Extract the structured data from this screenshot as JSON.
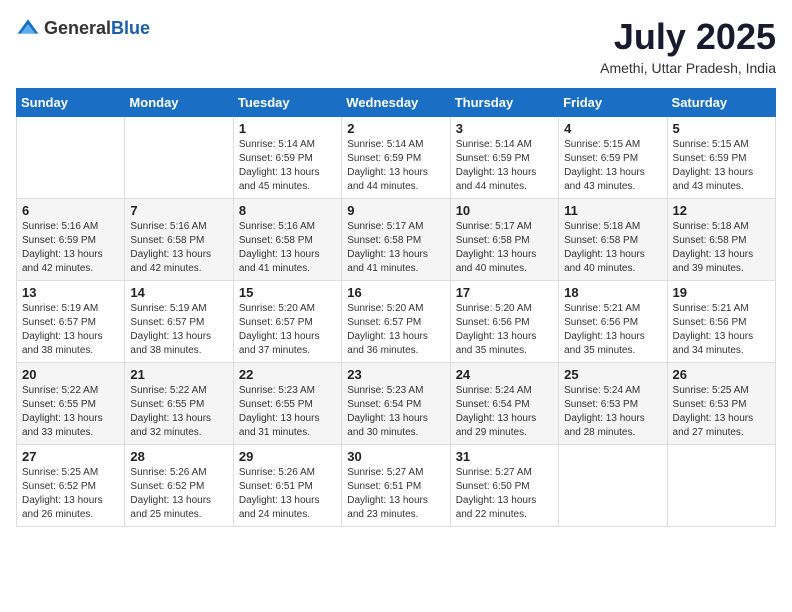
{
  "logo": {
    "general": "General",
    "blue": "Blue"
  },
  "title": "July 2025",
  "location": "Amethi, Uttar Pradesh, India",
  "days_of_week": [
    "Sunday",
    "Monday",
    "Tuesday",
    "Wednesday",
    "Thursday",
    "Friday",
    "Saturday"
  ],
  "weeks": [
    [
      {
        "day": "",
        "info": ""
      },
      {
        "day": "",
        "info": ""
      },
      {
        "day": "1",
        "info": "Sunrise: 5:14 AM\nSunset: 6:59 PM\nDaylight: 13 hours\nand 45 minutes."
      },
      {
        "day": "2",
        "info": "Sunrise: 5:14 AM\nSunset: 6:59 PM\nDaylight: 13 hours\nand 44 minutes."
      },
      {
        "day": "3",
        "info": "Sunrise: 5:14 AM\nSunset: 6:59 PM\nDaylight: 13 hours\nand 44 minutes."
      },
      {
        "day": "4",
        "info": "Sunrise: 5:15 AM\nSunset: 6:59 PM\nDaylight: 13 hours\nand 43 minutes."
      },
      {
        "day": "5",
        "info": "Sunrise: 5:15 AM\nSunset: 6:59 PM\nDaylight: 13 hours\nand 43 minutes."
      }
    ],
    [
      {
        "day": "6",
        "info": "Sunrise: 5:16 AM\nSunset: 6:59 PM\nDaylight: 13 hours\nand 42 minutes."
      },
      {
        "day": "7",
        "info": "Sunrise: 5:16 AM\nSunset: 6:58 PM\nDaylight: 13 hours\nand 42 minutes."
      },
      {
        "day": "8",
        "info": "Sunrise: 5:16 AM\nSunset: 6:58 PM\nDaylight: 13 hours\nand 41 minutes."
      },
      {
        "day": "9",
        "info": "Sunrise: 5:17 AM\nSunset: 6:58 PM\nDaylight: 13 hours\nand 41 minutes."
      },
      {
        "day": "10",
        "info": "Sunrise: 5:17 AM\nSunset: 6:58 PM\nDaylight: 13 hours\nand 40 minutes."
      },
      {
        "day": "11",
        "info": "Sunrise: 5:18 AM\nSunset: 6:58 PM\nDaylight: 13 hours\nand 40 minutes."
      },
      {
        "day": "12",
        "info": "Sunrise: 5:18 AM\nSunset: 6:58 PM\nDaylight: 13 hours\nand 39 minutes."
      }
    ],
    [
      {
        "day": "13",
        "info": "Sunrise: 5:19 AM\nSunset: 6:57 PM\nDaylight: 13 hours\nand 38 minutes."
      },
      {
        "day": "14",
        "info": "Sunrise: 5:19 AM\nSunset: 6:57 PM\nDaylight: 13 hours\nand 38 minutes."
      },
      {
        "day": "15",
        "info": "Sunrise: 5:20 AM\nSunset: 6:57 PM\nDaylight: 13 hours\nand 37 minutes."
      },
      {
        "day": "16",
        "info": "Sunrise: 5:20 AM\nSunset: 6:57 PM\nDaylight: 13 hours\nand 36 minutes."
      },
      {
        "day": "17",
        "info": "Sunrise: 5:20 AM\nSunset: 6:56 PM\nDaylight: 13 hours\nand 35 minutes."
      },
      {
        "day": "18",
        "info": "Sunrise: 5:21 AM\nSunset: 6:56 PM\nDaylight: 13 hours\nand 35 minutes."
      },
      {
        "day": "19",
        "info": "Sunrise: 5:21 AM\nSunset: 6:56 PM\nDaylight: 13 hours\nand 34 minutes."
      }
    ],
    [
      {
        "day": "20",
        "info": "Sunrise: 5:22 AM\nSunset: 6:55 PM\nDaylight: 13 hours\nand 33 minutes."
      },
      {
        "day": "21",
        "info": "Sunrise: 5:22 AM\nSunset: 6:55 PM\nDaylight: 13 hours\nand 32 minutes."
      },
      {
        "day": "22",
        "info": "Sunrise: 5:23 AM\nSunset: 6:55 PM\nDaylight: 13 hours\nand 31 minutes."
      },
      {
        "day": "23",
        "info": "Sunrise: 5:23 AM\nSunset: 6:54 PM\nDaylight: 13 hours\nand 30 minutes."
      },
      {
        "day": "24",
        "info": "Sunrise: 5:24 AM\nSunset: 6:54 PM\nDaylight: 13 hours\nand 29 minutes."
      },
      {
        "day": "25",
        "info": "Sunrise: 5:24 AM\nSunset: 6:53 PM\nDaylight: 13 hours\nand 28 minutes."
      },
      {
        "day": "26",
        "info": "Sunrise: 5:25 AM\nSunset: 6:53 PM\nDaylight: 13 hours\nand 27 minutes."
      }
    ],
    [
      {
        "day": "27",
        "info": "Sunrise: 5:25 AM\nSunset: 6:52 PM\nDaylight: 13 hours\nand 26 minutes."
      },
      {
        "day": "28",
        "info": "Sunrise: 5:26 AM\nSunset: 6:52 PM\nDaylight: 13 hours\nand 25 minutes."
      },
      {
        "day": "29",
        "info": "Sunrise: 5:26 AM\nSunset: 6:51 PM\nDaylight: 13 hours\nand 24 minutes."
      },
      {
        "day": "30",
        "info": "Sunrise: 5:27 AM\nSunset: 6:51 PM\nDaylight: 13 hours\nand 23 minutes."
      },
      {
        "day": "31",
        "info": "Sunrise: 5:27 AM\nSunset: 6:50 PM\nDaylight: 13 hours\nand 22 minutes."
      },
      {
        "day": "",
        "info": ""
      },
      {
        "day": "",
        "info": ""
      }
    ]
  ]
}
